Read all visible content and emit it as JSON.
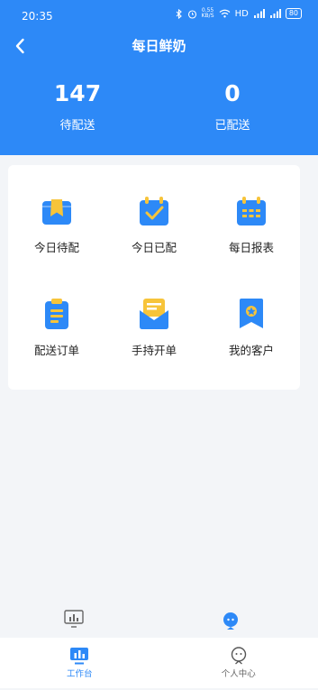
{
  "status_bar": {
    "time": "20:35",
    "network_speed": "0.55 KB/S",
    "hd_label": "HD",
    "battery": "80"
  },
  "header": {
    "title": "每日鲜奶"
  },
  "stats": [
    {
      "value": "147",
      "label": "待配送"
    },
    {
      "value": "0",
      "label": "已配送"
    }
  ],
  "menu": {
    "items": [
      {
        "label": "今日待配",
        "icon": "delivery-box-icon"
      },
      {
        "label": "今日已配",
        "icon": "calendar-check-icon"
      },
      {
        "label": "每日报表",
        "icon": "calendar-grid-icon"
      },
      {
        "label": "配送订单",
        "icon": "clipboard-icon"
      },
      {
        "label": "手持开单",
        "icon": "envelope-form-icon"
      },
      {
        "label": "我的客户",
        "icon": "customer-badge-icon"
      }
    ]
  },
  "tabbar": {
    "tabs": [
      {
        "label": "工作台",
        "icon": "workbench-chart-icon",
        "active": true
      },
      {
        "label": "个人中心",
        "icon": "person-icon",
        "active": false
      }
    ]
  },
  "colors": {
    "primary": "#2d89f7",
    "icon_yellow": "#f7c43a",
    "background": "#f3f5f8"
  }
}
